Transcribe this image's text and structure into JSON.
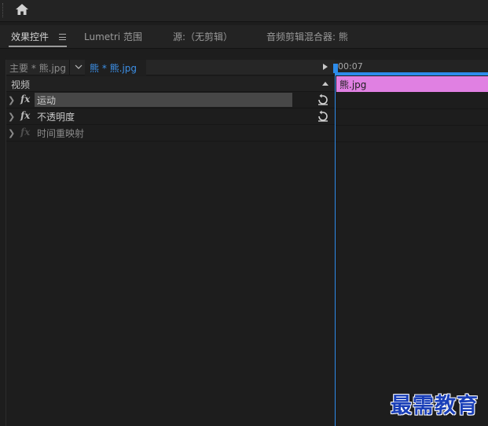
{
  "header": {
    "home_icon": "home-icon"
  },
  "tabs": [
    {
      "label": "效果控件",
      "active": true
    },
    {
      "label": "Lumetri 范围",
      "active": false
    },
    {
      "label": "源:（无剪辑）",
      "active": false
    },
    {
      "label": "音频剪辑混合器: 熊",
      "active": false
    }
  ],
  "clip_selector": {
    "master": "主要 * 熊.jpg",
    "sequence": "熊 * 熊.jpg"
  },
  "section": {
    "label": "视频"
  },
  "effects": [
    {
      "label": "运动",
      "enabled": true,
      "reset": true
    },
    {
      "label": "不透明度",
      "enabled": true,
      "reset": true
    },
    {
      "label": "时间重映射",
      "enabled": false,
      "reset": false
    }
  ],
  "timeline": {
    "timecode": "00:07",
    "clip_label": "熊.jpg",
    "clip_color": "#e080e2",
    "accent": "#2d8ceb"
  },
  "watermark": "最需教育"
}
